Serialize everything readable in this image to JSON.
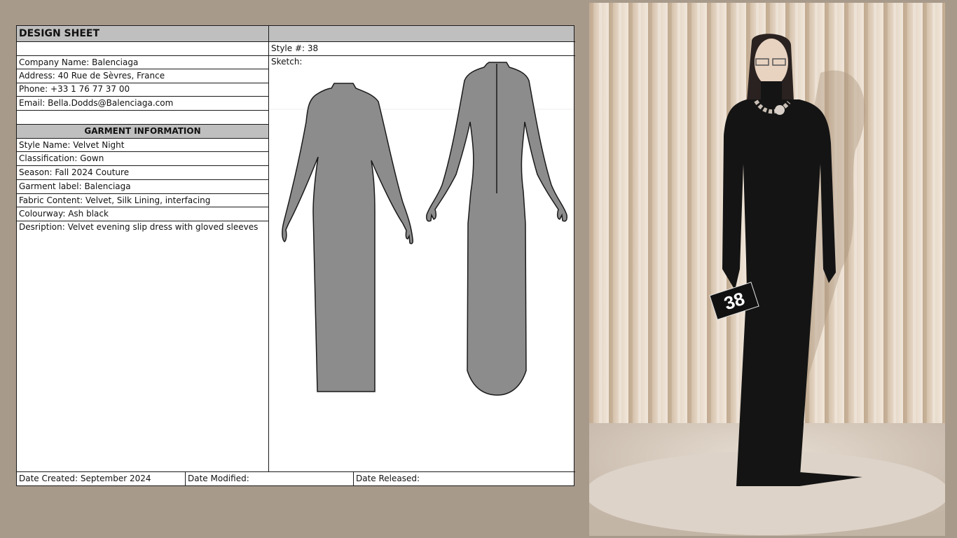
{
  "sheet": {
    "title": "DESIGN SHEET",
    "style_number": "Style #: 38",
    "sketch_label": "Sketch:",
    "company": {
      "name": "Company Name: Balenciaga",
      "address": "Address: 40 Rue de Sèvres, France",
      "phone": "Phone: +33 1 76 77 37 00",
      "email": "Email: Bella.Dodds@Balenciaga.com"
    },
    "garment_header": "GARMENT INFORMATION",
    "garment": {
      "style_name": "Style Name: Velvet Night",
      "classification": "Classification: Gown",
      "season": "Season: Fall 2024 Couture",
      "label": "Garment label: Balenciaga",
      "fabric": "Fabric Content: Velvet, Silk Lining, interfacing",
      "colourway": "Colourway: Ash black",
      "description": "Desription: Velvet evening slip dress with gloved sleeves"
    },
    "footer": {
      "created": "Date Created: September 2024",
      "modified": "Date Modified:",
      "released": "Date Released:"
    }
  },
  "photo": {
    "look_number": "38"
  },
  "colors": {
    "background": "#a89a8b",
    "header_gray": "#bfbfbf",
    "sketch_fill": "#8c8c8c",
    "dress": "#141414",
    "curtain": "#d9c8b4"
  }
}
